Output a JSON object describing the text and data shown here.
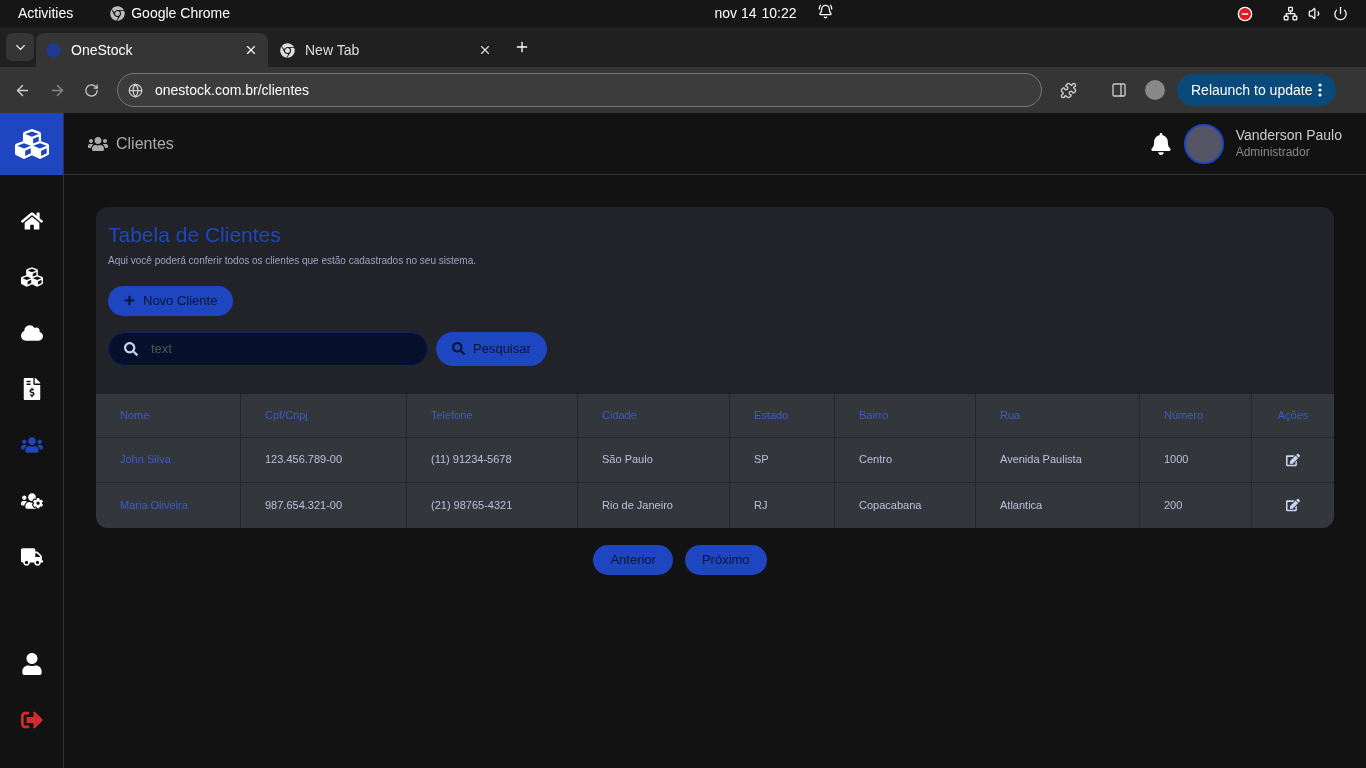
{
  "system_bar": {
    "activities": "Activities",
    "app_name": "Google Chrome",
    "date": "nov 14",
    "time": "10:22"
  },
  "browser": {
    "tabs": [
      {
        "title": "OneStock",
        "selected": true
      },
      {
        "title": "New Tab",
        "selected": false
      }
    ],
    "url": "onestock.com.br/clientes",
    "relaunch_button": "Relaunch to update"
  },
  "header": {
    "page_title": "Clientes",
    "user": {
      "name": "Vanderson Paulo",
      "role": "Administrador"
    }
  },
  "sidebar": {
    "items": [
      {
        "kind": "home",
        "selected": false
      },
      {
        "kind": "boxes",
        "selected": false
      },
      {
        "kind": "cloud",
        "selected": false
      },
      {
        "kind": "invoice",
        "selected": false
      },
      {
        "kind": "users",
        "selected": true
      },
      {
        "kind": "users-cog",
        "selected": false
      },
      {
        "kind": "truck",
        "selected": false
      }
    ],
    "bottom_items": [
      {
        "kind": "user",
        "selected": false
      },
      {
        "kind": "logout",
        "selected": false
      }
    ]
  },
  "card": {
    "title": "Tabela de Clientes",
    "subtitle": "Aqui você poderá conferir todos os clientes que estão cadastrados no seu sistema.",
    "new_button": "Novo Cliente",
    "search": {
      "placeholder": "text"
    },
    "search_button": "Pesquisar",
    "table": {
      "columns": [
        "Nome",
        "Cpf/Cnpj",
        "Telefone",
        "Cidade",
        "Estado",
        "Bairro",
        "Rua",
        "Número",
        "Ações"
      ],
      "rows": [
        [
          "John Silva",
          "123.456.789-00",
          "(11) 91234-5678",
          "São Paulo",
          "SP",
          "Centro",
          "Avenida Paulista",
          "1000"
        ],
        [
          "Maria Oliveira",
          "987.654.321-00",
          "(21) 98765-4321",
          "Rio de Janeiro",
          "RJ",
          "Copacabana",
          "Atlantica",
          "200"
        ]
      ]
    }
  },
  "pagination": [
    "Anterior",
    "Próximo"
  ]
}
